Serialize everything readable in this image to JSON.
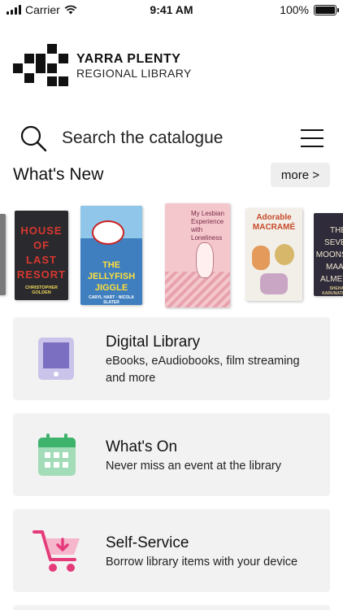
{
  "status_bar": {
    "carrier": "Carrier",
    "time": "9:41 AM",
    "battery": "100%"
  },
  "logo": {
    "line1": "YARRA PLENTY",
    "line2": "REGIONAL LIBRARY"
  },
  "search": {
    "placeholder": "Search the catalogue"
  },
  "whats_new": {
    "title": "What's New",
    "more_label": "more >",
    "books": [
      {
        "title": "HOUSE OF LAST RESORT",
        "author": "CHRISTOPHER GOLDEN",
        "color": "#2a2a2e"
      },
      {
        "title": "THE JELLYFISH JIGGLE",
        "author": "CARYL HART · NICOLA SLATER",
        "color": "#3f7fbf"
      },
      {
        "title": "My Lesbian Experience with Loneliness",
        "author": "",
        "color": "#f4c7cc"
      },
      {
        "title": "Adorable MACRAMÉ",
        "author": "",
        "color": "#f2efe9"
      },
      {
        "title": "THE SEVEN MOONS OF MAALI ALMEIDA",
        "author": "SHEHAN KARUNATILAKA",
        "color": "#2f2b3a"
      }
    ]
  },
  "cards": [
    {
      "title": "Digital Library",
      "subtitle": "eBooks, eAudiobooks, film streaming and more",
      "icon": "tablet-icon",
      "accent": "#7b6fc1"
    },
    {
      "title": "What's On",
      "subtitle": "Never miss an event at the library",
      "icon": "calendar-icon",
      "accent": "#3db36b"
    },
    {
      "title": "Self-Service",
      "subtitle": "Borrow library items with your device",
      "icon": "cart-icon",
      "accent": "#e53b7a"
    }
  ]
}
